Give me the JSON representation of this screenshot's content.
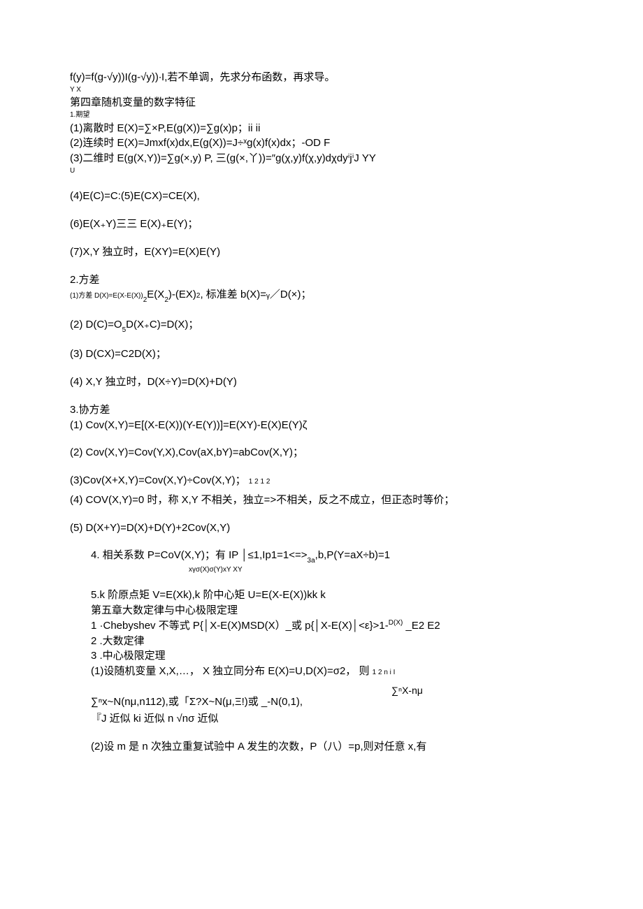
{
  "lines": {
    "l1": "f(y)=f(g-√y))I(g-√y))∙I,若不单调，先求分布函数，再求导。",
    "l1_sub": "Y               X",
    "l2": "第四章随机变量的数字特征",
    "l3": "1.期望",
    "l4": "(1)离散时 E(X)=∑×P,E(g(X))=∑g(x)p；ii                   ii",
    "l5": "(2)连续时 E(X)=Jmxf(x)dx,E(g(X))=J÷ˣg(x)f(x)dx；-OD        F",
    "l6": "(3)二维时 E(g(X,Y))=∑g(×,y) P, 三(g(×,丫))=″g(χ,y)f(χ,y)dχdyⁱjⁱJ         YY",
    "l6_sub": "                                  U",
    "l7": "(4)E(C)=C:(5)E(CX)=CE(X),",
    "l8": "(6)E(X₊Y)三三 E(X)₊E(Y)；",
    "l9": "(7)X,Y 独立时，E(XY)=E(X)E(Y)",
    "l10": "2.方差",
    "l11_a": "(1)方差 D(X)=E(X-E(X))",
    "l11_b": "2",
    "l11_c": "E(X",
    "l11_d": "2",
    "l11_e": ")-(EX)",
    "l11_f": "2",
    "l11_g": ", 标准差 b(X)=ᵧ／D(×)；",
    "l12": "(2)    D(C)=O",
    "l12b": "5",
    "l12c": "D(X₊C)=D(X)；",
    "l13": "(3)    D(CX)=C2D(X)；",
    "l14": "(4)    X,Y 独立时，D(X÷Y)=D(X)+D(Y)",
    "l15": "3.协方差",
    "l16": "(1)    Cov(X,Y)=E[(X-E(X))(Y-E(Y))]=E(XY)-E(X)E(Y)ζ",
    "l17": "(2)    Cov(X,Y)=Cov(Y,X),Cov(aX,bY)=abCov(X,Y)；",
    "l18": "(3)Cov(X+X,Y)=Cov(X,Y)÷Cov(X,Y)；",
    "l18_tail": "1            2             1            2",
    "l19": "(4)    COV(X,Y)=0 时，称 X,Y 不相关，独立=>不相关，反之不成立，但正态时等价；",
    "l20": "(5)    D(X+Y)=D(X)+D(Y)+2Cov(X,Y)",
    "l21": "4. 相关系数 P=CoV(X,Y)；有 IP              │≤1,Ip1=1<=>",
    "l21_t": "3a",
    "l21_e": ",b,P(Y=aX÷b)=1",
    "l21_sub": "xγσ(X)σ(Y)xY                                    XY",
    "l22": "5.k 阶原点矩 V=E(Xk),k 阶中心矩 U=E(X-E(X))kk  k",
    "l23": "第五章大数定律与中心极限定理",
    "l24": "1  ·Chebyshev 不等式 P{│X-E(X)MSD(X）_或 p{│X-E(X)│<ε}>1-",
    "l24_sup": "D(X)",
    "l24_end": " _E2            E2",
    "l25": "2  .大数定律",
    "l26": "3  .中心极限定理",
    "l27": "(1)设随机变量 X,X,…， X 独立同分布 E(X)=U,D(X)=σ2， 则 ",
    "l27_tail": "1  2                   n              i             I",
    "l28_right": "∑ⁿX-nμ",
    "l29": "∑ⁿx~N(nμ,n112),或「Σ?X~N(μ,Ξ!)或 _-N(0,1),",
    "l30": "『J 近似                          ki 近似 n                                    √nσ 近似",
    "l31": "(2)设 m 是 n 次独立重复试验中 A 发生的次数，P（八）=p,则对任意 x,有"
  }
}
